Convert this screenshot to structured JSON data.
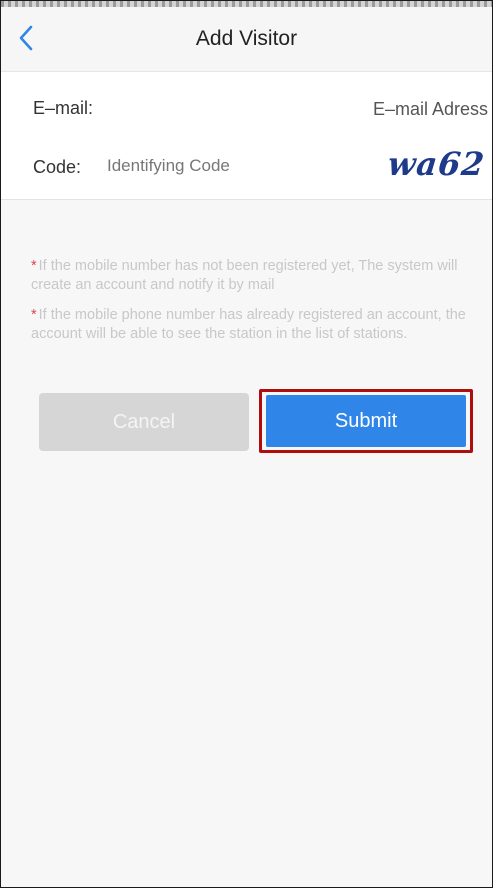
{
  "header": {
    "title": "Add Visitor",
    "back_icon": "chevron-left-icon"
  },
  "form": {
    "email_label": "E–mail:",
    "email_placeholder": "E–mail Adress",
    "code_label": "Code:",
    "code_placeholder": "Identifying Code",
    "captcha_text": "wa62"
  },
  "notices": [
    "If the mobile number has not been registered yet, The system will create an account and notify it by mail",
    "If the mobile phone number has already registered an account, the account will be able to see the station in the list of stations."
  ],
  "buttons": {
    "cancel_label": "Cancel",
    "submit_label": "Submit"
  },
  "colors": {
    "accent": "#2f86e8",
    "cancel_bg": "#d6d6d6",
    "highlight_border": "#b00d0d",
    "required_star": "#e24545",
    "captcha_ink": "#1e3a8a"
  }
}
